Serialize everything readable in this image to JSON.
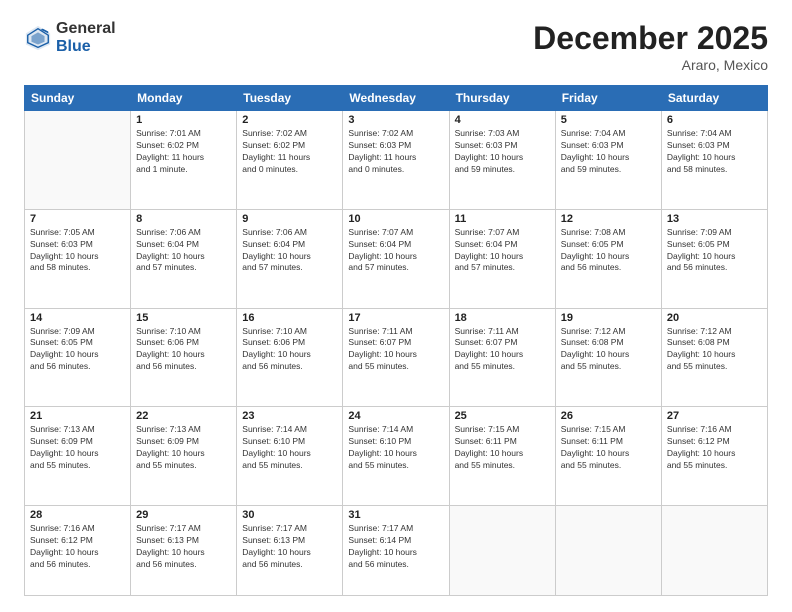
{
  "header": {
    "logo_general": "General",
    "logo_blue": "Blue",
    "month_title": "December 2025",
    "location": "Araro, Mexico"
  },
  "days_of_week": [
    "Sunday",
    "Monday",
    "Tuesday",
    "Wednesday",
    "Thursday",
    "Friday",
    "Saturday"
  ],
  "weeks": [
    [
      {
        "day": "",
        "info": ""
      },
      {
        "day": "1",
        "info": "Sunrise: 7:01 AM\nSunset: 6:02 PM\nDaylight: 11 hours\nand 1 minute."
      },
      {
        "day": "2",
        "info": "Sunrise: 7:02 AM\nSunset: 6:02 PM\nDaylight: 11 hours\nand 0 minutes."
      },
      {
        "day": "3",
        "info": "Sunrise: 7:02 AM\nSunset: 6:03 PM\nDaylight: 11 hours\nand 0 minutes."
      },
      {
        "day": "4",
        "info": "Sunrise: 7:03 AM\nSunset: 6:03 PM\nDaylight: 10 hours\nand 59 minutes."
      },
      {
        "day": "5",
        "info": "Sunrise: 7:04 AM\nSunset: 6:03 PM\nDaylight: 10 hours\nand 59 minutes."
      },
      {
        "day": "6",
        "info": "Sunrise: 7:04 AM\nSunset: 6:03 PM\nDaylight: 10 hours\nand 58 minutes."
      }
    ],
    [
      {
        "day": "7",
        "info": "Sunrise: 7:05 AM\nSunset: 6:03 PM\nDaylight: 10 hours\nand 58 minutes."
      },
      {
        "day": "8",
        "info": "Sunrise: 7:06 AM\nSunset: 6:04 PM\nDaylight: 10 hours\nand 57 minutes."
      },
      {
        "day": "9",
        "info": "Sunrise: 7:06 AM\nSunset: 6:04 PM\nDaylight: 10 hours\nand 57 minutes."
      },
      {
        "day": "10",
        "info": "Sunrise: 7:07 AM\nSunset: 6:04 PM\nDaylight: 10 hours\nand 57 minutes."
      },
      {
        "day": "11",
        "info": "Sunrise: 7:07 AM\nSunset: 6:04 PM\nDaylight: 10 hours\nand 57 minutes."
      },
      {
        "day": "12",
        "info": "Sunrise: 7:08 AM\nSunset: 6:05 PM\nDaylight: 10 hours\nand 56 minutes."
      },
      {
        "day": "13",
        "info": "Sunrise: 7:09 AM\nSunset: 6:05 PM\nDaylight: 10 hours\nand 56 minutes."
      }
    ],
    [
      {
        "day": "14",
        "info": "Sunrise: 7:09 AM\nSunset: 6:05 PM\nDaylight: 10 hours\nand 56 minutes."
      },
      {
        "day": "15",
        "info": "Sunrise: 7:10 AM\nSunset: 6:06 PM\nDaylight: 10 hours\nand 56 minutes."
      },
      {
        "day": "16",
        "info": "Sunrise: 7:10 AM\nSunset: 6:06 PM\nDaylight: 10 hours\nand 56 minutes."
      },
      {
        "day": "17",
        "info": "Sunrise: 7:11 AM\nSunset: 6:07 PM\nDaylight: 10 hours\nand 55 minutes."
      },
      {
        "day": "18",
        "info": "Sunrise: 7:11 AM\nSunset: 6:07 PM\nDaylight: 10 hours\nand 55 minutes."
      },
      {
        "day": "19",
        "info": "Sunrise: 7:12 AM\nSunset: 6:08 PM\nDaylight: 10 hours\nand 55 minutes."
      },
      {
        "day": "20",
        "info": "Sunrise: 7:12 AM\nSunset: 6:08 PM\nDaylight: 10 hours\nand 55 minutes."
      }
    ],
    [
      {
        "day": "21",
        "info": "Sunrise: 7:13 AM\nSunset: 6:09 PM\nDaylight: 10 hours\nand 55 minutes."
      },
      {
        "day": "22",
        "info": "Sunrise: 7:13 AM\nSunset: 6:09 PM\nDaylight: 10 hours\nand 55 minutes."
      },
      {
        "day": "23",
        "info": "Sunrise: 7:14 AM\nSunset: 6:10 PM\nDaylight: 10 hours\nand 55 minutes."
      },
      {
        "day": "24",
        "info": "Sunrise: 7:14 AM\nSunset: 6:10 PM\nDaylight: 10 hours\nand 55 minutes."
      },
      {
        "day": "25",
        "info": "Sunrise: 7:15 AM\nSunset: 6:11 PM\nDaylight: 10 hours\nand 55 minutes."
      },
      {
        "day": "26",
        "info": "Sunrise: 7:15 AM\nSunset: 6:11 PM\nDaylight: 10 hours\nand 55 minutes."
      },
      {
        "day": "27",
        "info": "Sunrise: 7:16 AM\nSunset: 6:12 PM\nDaylight: 10 hours\nand 55 minutes."
      }
    ],
    [
      {
        "day": "28",
        "info": "Sunrise: 7:16 AM\nSunset: 6:12 PM\nDaylight: 10 hours\nand 56 minutes."
      },
      {
        "day": "29",
        "info": "Sunrise: 7:17 AM\nSunset: 6:13 PM\nDaylight: 10 hours\nand 56 minutes."
      },
      {
        "day": "30",
        "info": "Sunrise: 7:17 AM\nSunset: 6:13 PM\nDaylight: 10 hours\nand 56 minutes."
      },
      {
        "day": "31",
        "info": "Sunrise: 7:17 AM\nSunset: 6:14 PM\nDaylight: 10 hours\nand 56 minutes."
      },
      {
        "day": "",
        "info": ""
      },
      {
        "day": "",
        "info": ""
      },
      {
        "day": "",
        "info": ""
      }
    ]
  ]
}
